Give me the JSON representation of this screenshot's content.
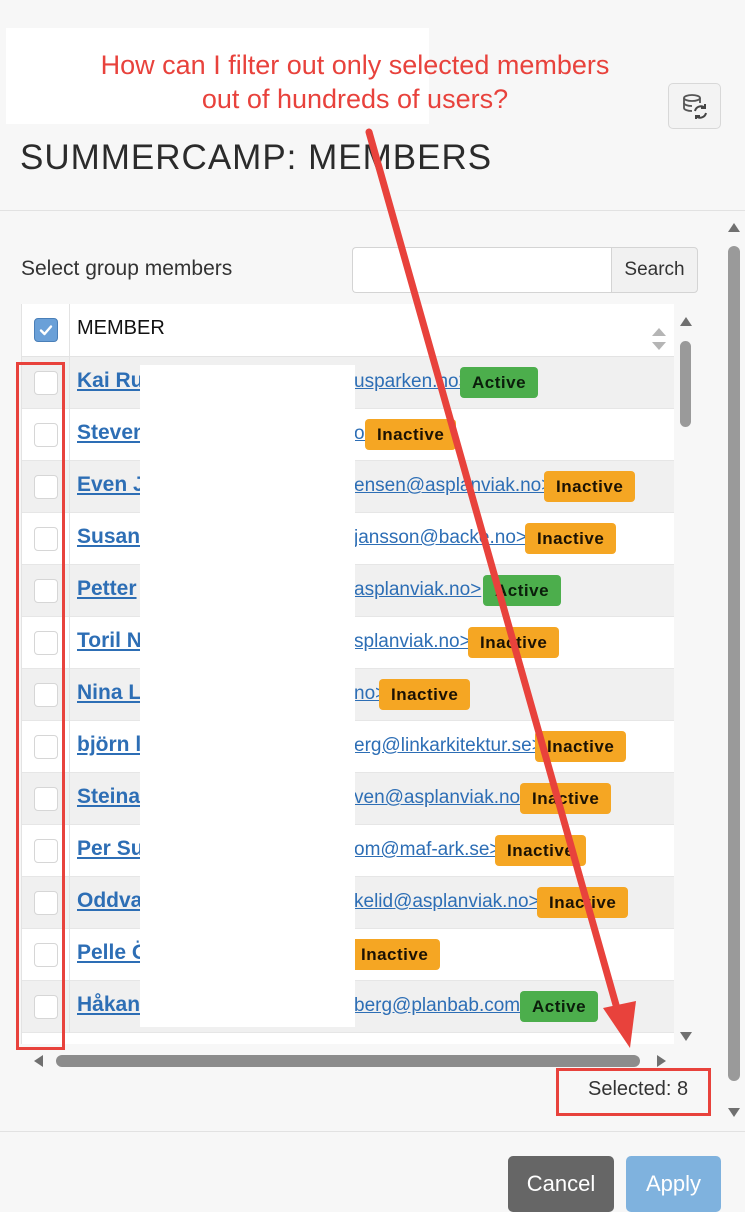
{
  "annotation": {
    "line1": "How can I filter out only selected members",
    "line2": "out of hundreds of users?"
  },
  "header": {
    "title": "SUMMERCAMP: MEMBERS",
    "refresh_icon": "database-refresh-icon"
  },
  "toolbar": {
    "select_label": "Select group members",
    "search_value": "",
    "search_button": "Search"
  },
  "table": {
    "column_header": "MEMBER",
    "header_checked": true,
    "rows": [
      {
        "name": "Kai Ru",
        "email": "usparken.no>",
        "status": "Active"
      },
      {
        "name": "Steven",
        "email": "o>",
        "status": "Inactive"
      },
      {
        "name": "Even J",
        "email": "ensen@asplanviak.no>",
        "status": "Inactive"
      },
      {
        "name": "Susan",
        "email": "jansson@backe.no>",
        "status": "Inactive"
      },
      {
        "name": "Petter",
        "email": "asplanviak.no>",
        "status": "Active"
      },
      {
        "name": "Toril N",
        "email": "splanviak.no>",
        "status": "Inactive"
      },
      {
        "name": "Nina L",
        "email": "no>",
        "status": "Inactive"
      },
      {
        "name": "björn l",
        "email": "erg@linkarkitektur.se>",
        "status": "Inactive"
      },
      {
        "name": "Steina",
        "email": "ven@asplanviak.no>",
        "status": "Inactive"
      },
      {
        "name": "Per Su",
        "email": "om@maf-ark.se>",
        "status": "Inactive"
      },
      {
        "name": "Oddva",
        "email": "kelid@asplanviak.no>",
        "status": "Inactive"
      },
      {
        "name": "Pelle Ö",
        "email": ">",
        "status": "Inactive"
      },
      {
        "name": "Håkan",
        "email": "berg@planbab.com>",
        "status": "Active"
      }
    ]
  },
  "footer": {
    "selected_label": "Selected: 8",
    "cancel": "Cancel",
    "apply": "Apply"
  },
  "colors": {
    "active": "#4cae4c",
    "inactive": "#f5a623",
    "link": "#2d6eb5",
    "annotation": "#e8423c",
    "apply": "#7fb2de",
    "cancel": "#666666"
  }
}
